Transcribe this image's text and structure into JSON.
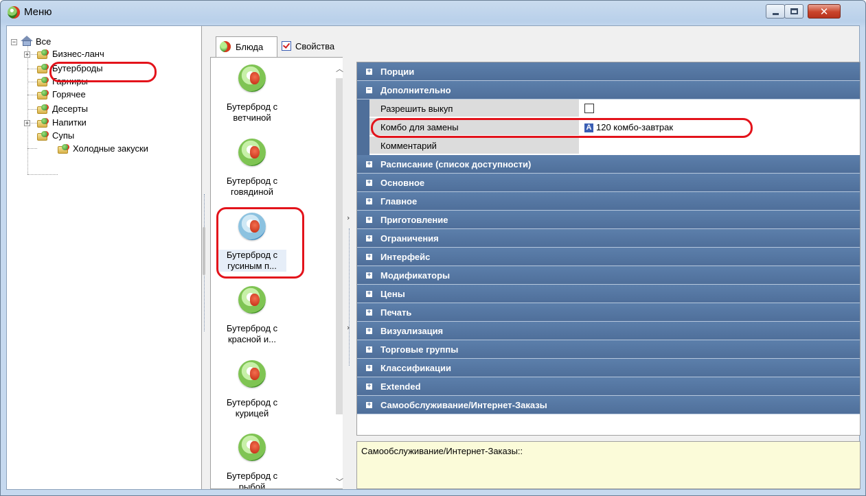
{
  "window": {
    "title": "Меню"
  },
  "tree": {
    "root": "Все",
    "items": [
      {
        "label": "Бизнес-ланч",
        "expandable": true
      },
      {
        "label": "Бутерброды",
        "expandable": false,
        "highlighted": true
      },
      {
        "label": "Гарниры",
        "expandable": false
      },
      {
        "label": "Горячее",
        "expandable": false
      },
      {
        "label": "Десерты",
        "expandable": false
      },
      {
        "label": "Напитки",
        "expandable": true
      },
      {
        "label": "Супы",
        "expandable": false
      },
      {
        "label": "Холодные закуски",
        "expandable": false
      }
    ]
  },
  "tabs": {
    "dishes": "Блюда",
    "properties": "Свойства"
  },
  "dishes": [
    {
      "line1": "Бутерброд с",
      "line2": "ветчиной"
    },
    {
      "line1": "Бутерброд с",
      "line2": "говядиной"
    },
    {
      "line1": "Бутерброд с",
      "line2": "гусиным п...",
      "selected": true
    },
    {
      "line1": "Бутерброд с",
      "line2": "красной и..."
    },
    {
      "line1": "Бутерброд с",
      "line2": "курицей"
    },
    {
      "line1": "Бутерброд с",
      "line2": "рыбой"
    }
  ],
  "properties": {
    "portions": "Порции",
    "additional": "Дополнительно",
    "allow_buyout_label": "Разрешить выкуп",
    "combo_label": "Комбо для замены",
    "combo_badge": "A",
    "combo_value": "120 комбо-завтрак",
    "comment_label": "Комментарий",
    "categories_after": [
      "Расписание (список доступности)",
      "Основное",
      "Главное",
      "Приготовление",
      "Ограничения",
      "Интерфейс",
      "Модификаторы",
      "Цены",
      "Печать",
      "Визуализация",
      "Торговые группы",
      "Классификации",
      "Extended",
      "Самообслуживание/Интернет-Заказы"
    ]
  },
  "description": "Самообслуживание/Интернет-Заказы::",
  "colors": {
    "category_bar": "#4f6f9a",
    "highlight_oval": "#e3131b",
    "description_bg": "#fbfbd9"
  }
}
